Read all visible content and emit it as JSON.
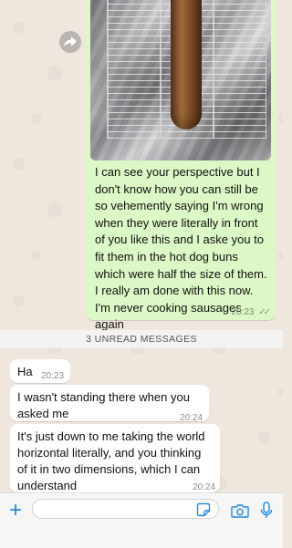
{
  "chat": {
    "outgoing": {
      "text": "I can see your perspective but I don't know how you can still be so vehemently saying I'm wrong when they were literally in front of you like this and I aske you to fit them in the hot dog buns which were half the size of them. I really am done with this now. I'm never cooking sausages again",
      "time": "20:23",
      "has_photo": true,
      "status_icon": "double-check-icon"
    },
    "unread_divider": "3 UNREAD MESSAGES",
    "incoming": [
      {
        "text": "Ha",
        "time": "20:23"
      },
      {
        "text": "I wasn't standing there when you asked me",
        "time": "20:24"
      },
      {
        "text": "It's just down to me taking the world horizontal literally, and you thinking of it in two dimensions, which I can understand",
        "time": "20:24"
      }
    ]
  },
  "input_bar": {
    "placeholder": "",
    "icons": [
      "plus-icon",
      "sticker-icon",
      "camera-icon",
      "microphone-icon"
    ],
    "accent_color": "#1e88e5"
  },
  "colors": {
    "outgoing_bubble": "#dcf8c6",
    "incoming_bubble": "#ffffff",
    "background": "#efe7de"
  }
}
